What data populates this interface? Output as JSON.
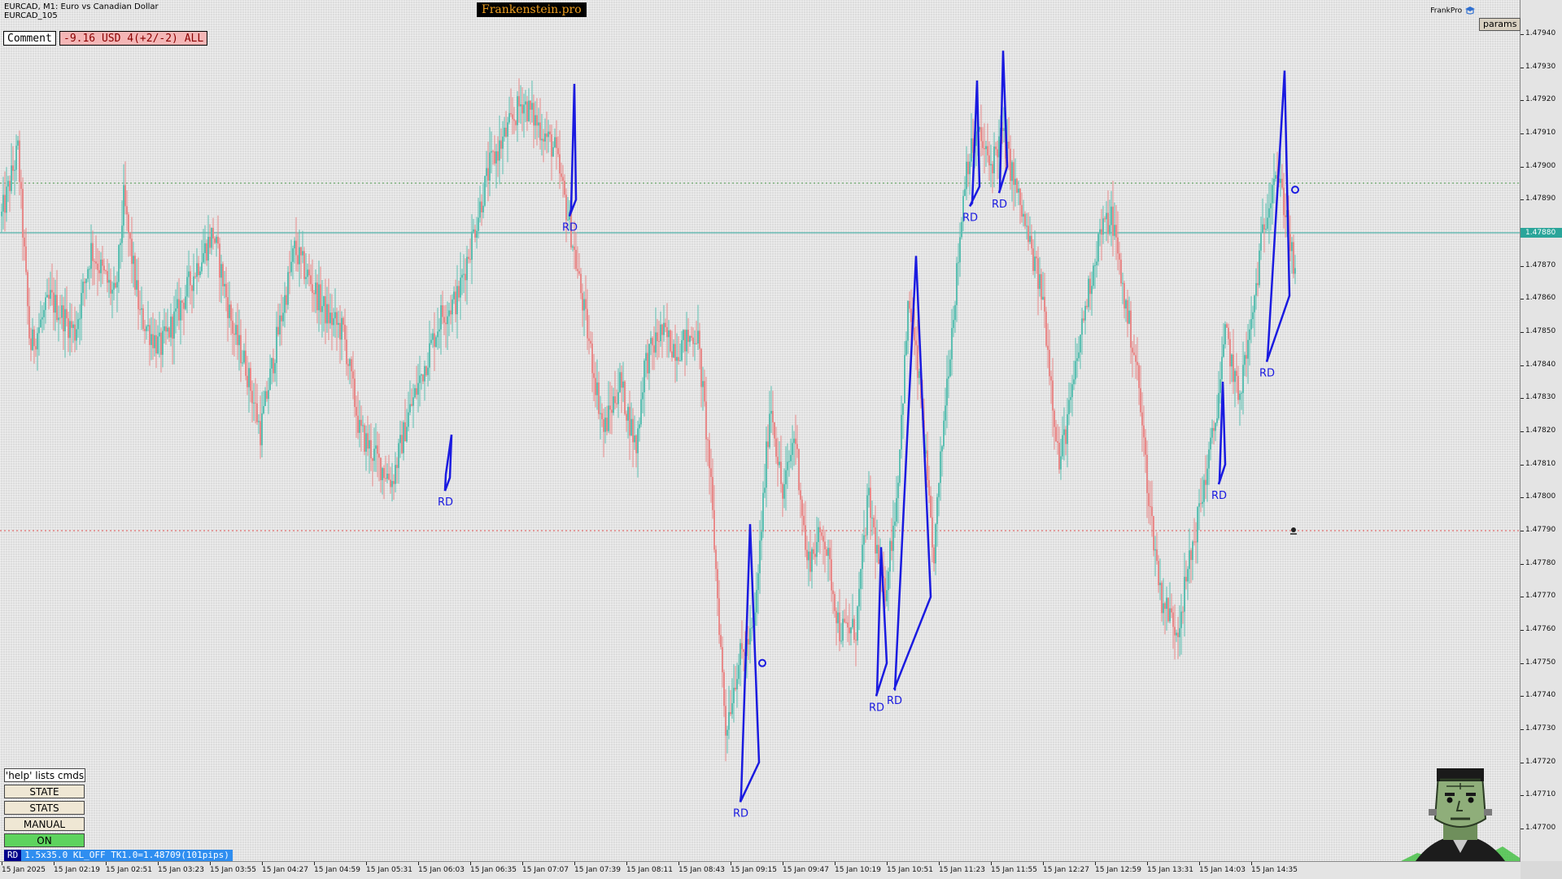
{
  "header": {
    "symbol_line": "EURCAD, M1:  Euro vs Canadian Dollar",
    "template_name": "EURCAD_105",
    "brand": "Frankenstein.pro",
    "user": "FrankPro",
    "params_button": "params"
  },
  "comment": {
    "label": "Comment",
    "value": "-9.16 USD 4(+2/-2) ALL"
  },
  "panel": {
    "help": "'help' lists cmds",
    "state": "STATE",
    "stats": "STATS",
    "manual": "MANUAL",
    "on": "ON"
  },
  "status_bar": {
    "tag": "RD",
    "text": "1.5x35.0 KL_OFF TK1.0=1.48709(101pips)"
  },
  "icons": [
    "graduation-cap-icon",
    "skull-icon",
    "frankenstein-mascot-icon"
  ],
  "colors": {
    "bull": "#5dbfb2",
    "bear": "#e88a8a",
    "zigzag": "#1a1ae0",
    "current_price_line": "#2aa59a",
    "upper_level": "#4c9a4c",
    "lower_level": "#e05050"
  },
  "chart_data": {
    "type": "candlestick",
    "symbol": "EURCAD",
    "timeframe": "M1",
    "ylim": [
      1.4769,
      1.4795
    ],
    "y_ticks": [
      "1.47940",
      "1.47930",
      "1.47920",
      "1.47910",
      "1.47900",
      "1.47890",
      "1.47880",
      "1.47870",
      "1.47860",
      "1.47850",
      "1.47840",
      "1.47830",
      "1.47820",
      "1.47810",
      "1.47800",
      "1.47790",
      "1.47780",
      "1.47770",
      "1.47760",
      "1.47750",
      "1.47740",
      "1.47730",
      "1.47720",
      "1.47710",
      "1.47700"
    ],
    "x_ticks": [
      "15 Jan 2025",
      "15 Jan 02:19",
      "15 Jan 02:51",
      "15 Jan 03:23",
      "15 Jan 03:55",
      "15 Jan 04:27",
      "15 Jan 04:59",
      "15 Jan 05:31",
      "15 Jan 06:03",
      "15 Jan 06:35",
      "15 Jan 07:07",
      "15 Jan 07:39",
      "15 Jan 08:11",
      "15 Jan 08:43",
      "15 Jan 09:15",
      "15 Jan 09:47",
      "15 Jan 10:19",
      "15 Jan 10:51",
      "15 Jan 11:23",
      "15 Jan 11:55",
      "15 Jan 12:27",
      "15 Jan 12:59",
      "15 Jan 13:31",
      "15 Jan 14:03",
      "15 Jan 14:35"
    ],
    "current_price": "1.47880",
    "levels": [
      {
        "price": 1.47895,
        "style": "dotted",
        "color": "#4c9a4c"
      },
      {
        "price": 1.4788,
        "style": "solid",
        "color": "#2aa59a"
      },
      {
        "price": 1.4779,
        "style": "dotted",
        "color": "#e05050"
      }
    ],
    "close_path": [
      [
        0,
        1.47885
      ],
      [
        20,
        1.47905
      ],
      [
        35,
        1.47845
      ],
      [
        60,
        1.4786
      ],
      [
        90,
        1.4785
      ],
      [
        110,
        1.47875
      ],
      [
        140,
        1.4786
      ],
      [
        150,
        1.4789
      ],
      [
        170,
        1.47855
      ],
      [
        195,
        1.47845
      ],
      [
        215,
        1.47855
      ],
      [
        240,
        1.4787
      ],
      [
        260,
        1.4788
      ],
      [
        285,
        1.4785
      ],
      [
        300,
        1.4784
      ],
      [
        318,
        1.4782
      ],
      [
        340,
        1.4785
      ],
      [
        360,
        1.47875
      ],
      [
        380,
        1.47865
      ],
      [
        400,
        1.47855
      ],
      [
        420,
        1.4785
      ],
      [
        440,
        1.4782
      ],
      [
        465,
        1.4781
      ],
      [
        480,
        1.47805
      ],
      [
        500,
        1.47825
      ],
      [
        520,
        1.4784
      ],
      [
        540,
        1.47855
      ],
      [
        560,
        1.4786
      ],
      [
        580,
        1.4788
      ],
      [
        600,
        1.479
      ],
      [
        640,
        1.4792
      ],
      [
        680,
        1.47905
      ],
      [
        700,
        1.4788
      ],
      [
        720,
        1.4785
      ],
      [
        740,
        1.4782
      ],
      [
        760,
        1.47835
      ],
      [
        780,
        1.47815
      ],
      [
        790,
        1.4784
      ],
      [
        810,
        1.4785
      ],
      [
        830,
        1.47845
      ],
      [
        855,
        1.4785
      ],
      [
        870,
        1.4781
      ],
      [
        880,
        1.4777
      ],
      [
        890,
        1.4773
      ],
      [
        905,
        1.4775
      ],
      [
        925,
        1.4776
      ],
      [
        945,
        1.4783
      ],
      [
        960,
        1.478
      ],
      [
        975,
        1.4782
      ],
      [
        990,
        1.4778
      ],
      [
        1010,
        1.4779
      ],
      [
        1030,
        1.4776
      ],
      [
        1050,
        1.4776
      ],
      [
        1065,
        1.478
      ],
      [
        1085,
        1.4777
      ],
      [
        1100,
        1.478
      ],
      [
        1115,
        1.4786
      ],
      [
        1130,
        1.4783
      ],
      [
        1145,
        1.4778
      ],
      [
        1160,
        1.4783
      ],
      [
        1175,
        1.4787
      ],
      [
        1185,
        1.479
      ],
      [
        1200,
        1.4791
      ],
      [
        1215,
        1.479
      ],
      [
        1230,
        1.4791
      ],
      [
        1245,
        1.47895
      ],
      [
        1260,
        1.4788
      ],
      [
        1280,
        1.4786
      ],
      [
        1300,
        1.4781
      ],
      [
        1315,
        1.4783
      ],
      [
        1330,
        1.47855
      ],
      [
        1350,
        1.4788
      ],
      [
        1365,
        1.47885
      ],
      [
        1380,
        1.4786
      ],
      [
        1395,
        1.4784
      ],
      [
        1410,
        1.478
      ],
      [
        1425,
        1.4777
      ],
      [
        1445,
        1.4776
      ],
      [
        1460,
        1.4778
      ],
      [
        1475,
        1.478
      ],
      [
        1490,
        1.4782
      ],
      [
        1505,
        1.4785
      ],
      [
        1520,
        1.4783
      ],
      [
        1535,
        1.4785
      ],
      [
        1550,
        1.4788
      ],
      [
        1565,
        1.479
      ],
      [
        1580,
        1.47885
      ],
      [
        1590,
        1.47865
      ]
    ],
    "signals": [
      {
        "label": "RD",
        "path": [
          [
            547,
            1.47802
          ],
          [
            553,
            1.47806
          ],
          [
            555,
            1.47819
          ],
          [
            548,
            1.47807
          ],
          [
            547,
            1.47802
          ]
        ],
        "anchor": [
          547,
          1.47802
        ]
      },
      {
        "label": "RD",
        "path": [
          [
            700,
            1.47885
          ],
          [
            708,
            1.4789
          ],
          [
            706,
            1.47925
          ],
          [
            702,
            1.47887
          ],
          [
            700,
            1.47885
          ]
        ],
        "anchor": [
          700,
          1.47885
        ]
      },
      {
        "label": "RD",
        "path": [
          [
            910,
            1.47708
          ],
          [
            933,
            1.4772
          ],
          [
            922,
            1.47792
          ],
          [
            911,
            1.4771
          ],
          [
            910,
            1.47708
          ]
        ],
        "anchor": [
          910,
          1.47708
        ]
      },
      {
        "label": "RD",
        "path": [
          [
            1077,
            1.4774
          ],
          [
            1090,
            1.4775
          ],
          [
            1083,
            1.47785
          ],
          [
            1078,
            1.47741
          ],
          [
            1077,
            1.4774
          ]
        ],
        "anchor": [
          1077,
          1.4774
        ]
      },
      {
        "label": "RD",
        "path": [
          [
            1099,
            1.47742
          ],
          [
            1144,
            1.4777
          ],
          [
            1126,
            1.47873
          ],
          [
            1100,
            1.47742
          ],
          [
            1099,
            1.47742
          ]
        ],
        "anchor": [
          1099,
          1.47742
        ]
      },
      {
        "label": "RD",
        "path": [
          [
            1192,
            1.47888
          ],
          [
            1204,
            1.47894
          ],
          [
            1201,
            1.47926
          ],
          [
            1195,
            1.47889
          ],
          [
            1192,
            1.47888
          ]
        ],
        "anchor": [
          1192,
          1.47888
        ]
      },
      {
        "label": "RD",
        "path": [
          [
            1228,
            1.47892
          ],
          [
            1238,
            1.479
          ],
          [
            1233,
            1.47935
          ],
          [
            1229,
            1.47893
          ],
          [
            1228,
            1.47892
          ]
        ],
        "anchor": [
          1228,
          1.47892
        ]
      },
      {
        "label": "RD",
        "path": [
          [
            1498,
            1.47804
          ],
          [
            1506,
            1.4781
          ],
          [
            1503,
            1.47835
          ],
          [
            1499,
            1.47805
          ],
          [
            1498,
            1.47804
          ]
        ],
        "anchor": [
          1498,
          1.47804
        ]
      },
      {
        "label": "RD",
        "path": [
          [
            1557,
            1.47841
          ],
          [
            1585,
            1.47861
          ],
          [
            1579,
            1.47929
          ],
          [
            1558,
            1.47842
          ],
          [
            1557,
            1.47841
          ]
        ],
        "anchor": [
          1557,
          1.47841
        ]
      }
    ]
  }
}
